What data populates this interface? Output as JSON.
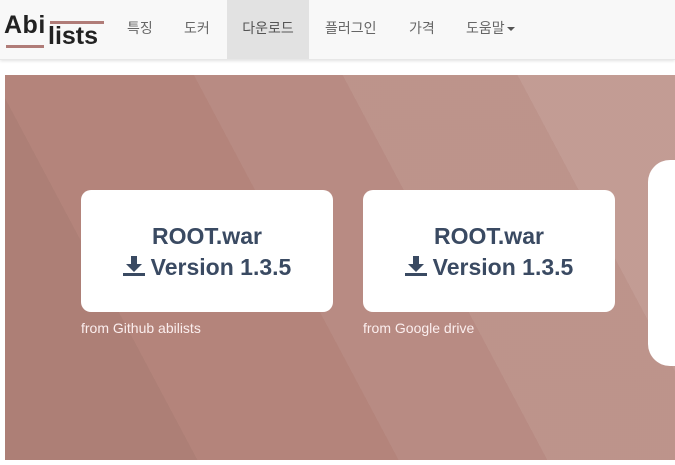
{
  "brand": {
    "logo_text_top": "Abi",
    "logo_text_bottom": "lists",
    "accent_color": "#b07c78"
  },
  "nav": {
    "items": [
      {
        "label": "특징"
      },
      {
        "label": "도커"
      },
      {
        "label": "다운로드",
        "active": true
      },
      {
        "label": "플러그인"
      },
      {
        "label": "가격"
      },
      {
        "label": "도움말",
        "dropdown": true
      }
    ]
  },
  "downloads": [
    {
      "title": "ROOT.war",
      "version": "Version 1.3.5",
      "icon": "download-icon",
      "caption": "from Github abilists"
    },
    {
      "title": "ROOT.war",
      "version": "Version 1.3.5",
      "icon": "download-icon",
      "caption": "from Google drive"
    }
  ],
  "colors": {
    "hero_bg": "#b4847b",
    "card_text": "#3a4a62"
  }
}
